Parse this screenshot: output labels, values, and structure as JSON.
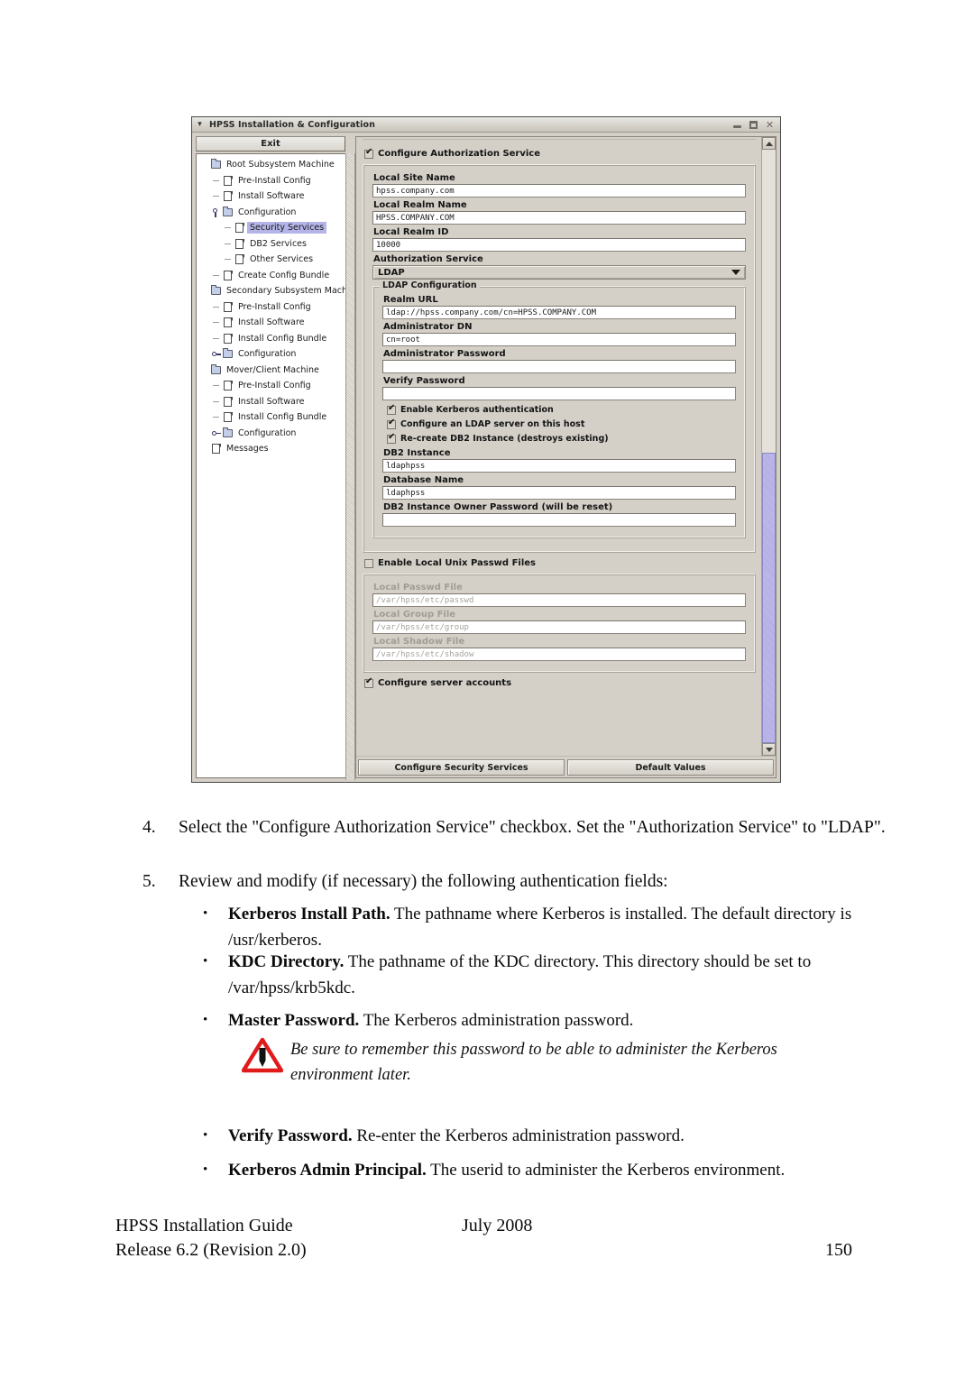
{
  "window": {
    "title": "HPSS Installation & Configuration",
    "menu_glyph": "▾",
    "minimize": "_",
    "maximize": "□",
    "close": "✕"
  },
  "sidebar": {
    "exit_label": "Exit",
    "items": [
      {
        "label": "Root Subsystem Machine",
        "icon": "folder-icon",
        "depth": 0,
        "handle": "none",
        "selected": false
      },
      {
        "label": "Pre-Install Config",
        "icon": "file-icon",
        "depth": 1,
        "handle": "dash",
        "selected": false
      },
      {
        "label": "Install Software",
        "icon": "file-icon",
        "depth": 1,
        "handle": "dash",
        "selected": false
      },
      {
        "label": "Configuration",
        "icon": "folder-icon",
        "depth": 1,
        "handle": "key-vertical",
        "selected": false
      },
      {
        "label": "Security Services",
        "icon": "file-icon",
        "depth": 2,
        "handle": "dash",
        "selected": true
      },
      {
        "label": "DB2 Services",
        "icon": "file-icon",
        "depth": 2,
        "handle": "dash",
        "selected": false
      },
      {
        "label": "Other Services",
        "icon": "file-icon",
        "depth": 2,
        "handle": "dash",
        "selected": false
      },
      {
        "label": "Create Config Bundle",
        "icon": "file-icon",
        "depth": 1,
        "handle": "dash",
        "selected": false
      },
      {
        "label": "Secondary Subsystem Machine",
        "icon": "folder-icon",
        "depth": 0,
        "handle": "none",
        "selected": false
      },
      {
        "label": "Pre-Install Config",
        "icon": "file-icon",
        "depth": 1,
        "handle": "dash",
        "selected": false
      },
      {
        "label": "Install Software",
        "icon": "file-icon",
        "depth": 1,
        "handle": "dash",
        "selected": false
      },
      {
        "label": "Install Config Bundle",
        "icon": "file-icon",
        "depth": 1,
        "handle": "dash",
        "selected": false
      },
      {
        "label": "Configuration",
        "icon": "folder-icon",
        "depth": 1,
        "handle": "key",
        "selected": false
      },
      {
        "label": "Mover/Client Machine",
        "icon": "folder-icon",
        "depth": 0,
        "handle": "none",
        "selected": false
      },
      {
        "label": "Pre-Install Config",
        "icon": "file-icon",
        "depth": 1,
        "handle": "dash",
        "selected": false
      },
      {
        "label": "Install Software",
        "icon": "file-icon",
        "depth": 1,
        "handle": "dash",
        "selected": false
      },
      {
        "label": "Install Config Bundle",
        "icon": "file-icon",
        "depth": 1,
        "handle": "dash",
        "selected": false
      },
      {
        "label": "Configuration",
        "icon": "folder-icon",
        "depth": 1,
        "handle": "key",
        "selected": false
      },
      {
        "label": "Messages",
        "icon": "file-icon",
        "depth": 0,
        "handle": "none",
        "selected": false
      }
    ]
  },
  "form": {
    "configure_authorization_service": "Configure Authorization Service",
    "local_site_name_label": "Local Site Name",
    "local_site_name_value": "hpss.company.com",
    "local_realm_name_label": "Local Realm Name",
    "local_realm_name_value": "HPSS.COMPANY.COM",
    "local_realm_id_label": "Local Realm ID",
    "local_realm_id_value": "10000",
    "authorization_service_label": "Authorization Service",
    "authorization_service_value": "LDAP",
    "ldap_group_title": "LDAP Configuration",
    "realm_url_label": "Realm URL",
    "realm_url_value": "ldap://hpss.company.com/cn=HPSS.COMPANY.COM",
    "administrator_dn_label": "Administrator DN",
    "administrator_dn_value": "cn=root",
    "administrator_password_label": "Administrator Password",
    "administrator_password_value": "",
    "verify_password_label": "Verify Password",
    "verify_password_value": "",
    "enable_kerberos_label": "Enable Kerberos authentication",
    "configure_ldap_server_label": "Configure an LDAP server on this host",
    "recreate_db2_label": "Re-create DB2 Instance (destroys existing)",
    "db2_instance_label": "DB2 Instance",
    "db2_instance_value": "ldaphpss",
    "database_name_label": "Database Name",
    "database_name_value": "ldaphpss",
    "db2_owner_password_label": "DB2 Instance Owner Password (will be reset)",
    "db2_owner_password_value": "",
    "enable_local_unix_label": "Enable Local Unix Passwd Files",
    "local_passwd_file_label": "Local Passwd File",
    "local_passwd_file_value": "/var/hpss/etc/passwd",
    "local_group_file_label": "Local Group File",
    "local_group_file_value": "/var/hpss/etc/group",
    "local_shadow_file_label": "Local Shadow File",
    "local_shadow_file_value": "/var/hpss/etc/shadow",
    "configure_server_accounts_label": "Configure server accounts",
    "configure_security_services_btn": "Configure Security Services",
    "default_values_btn": "Default Values"
  },
  "document": {
    "step4_num": "4.",
    "step4_text": "Select the \"Configure Authorization Service\" checkbox.  Set the \"Authorization Service\" to \"LDAP\".",
    "step5_num": "5.",
    "step5_text": "Review and modify (if necessary) the following authentication fields:",
    "bullet_marker": "•",
    "b1_term": "Kerberos Install Path.",
    "b1_text": "  The pathname where Kerberos is installed.  The default directory is /usr/kerberos.",
    "b2_term": "KDC Directory.",
    "b2_text": "  The pathname of the KDC directory.  This directory should be set to /var/hpss/krb5kdc.",
    "b3_term": "Master Password.",
    "b3_text": "  The Kerberos administration password.",
    "warning_text": "Be sure to remember this password to be able to administer the Kerberos environment later.",
    "b4_term": "Verify Password.",
    "b4_text": "  Re-enter the Kerberos administration password.",
    "b5_term": "Kerberos Admin Principal.",
    "b5_text": "  The userid to administer the Kerberos environment.",
    "footer_left_1": "HPSS Installation Guide",
    "footer_mid_1": "July 2008",
    "footer_left_2": "Release 6.2 (Revision 2.0)",
    "footer_right_2": "150"
  },
  "colors": {
    "window_face": "#d4d0c8",
    "selection": "#b4b4e8",
    "scrollbar_thumb": "#aaa6e0",
    "warning_triangle": "#e01b1b"
  }
}
